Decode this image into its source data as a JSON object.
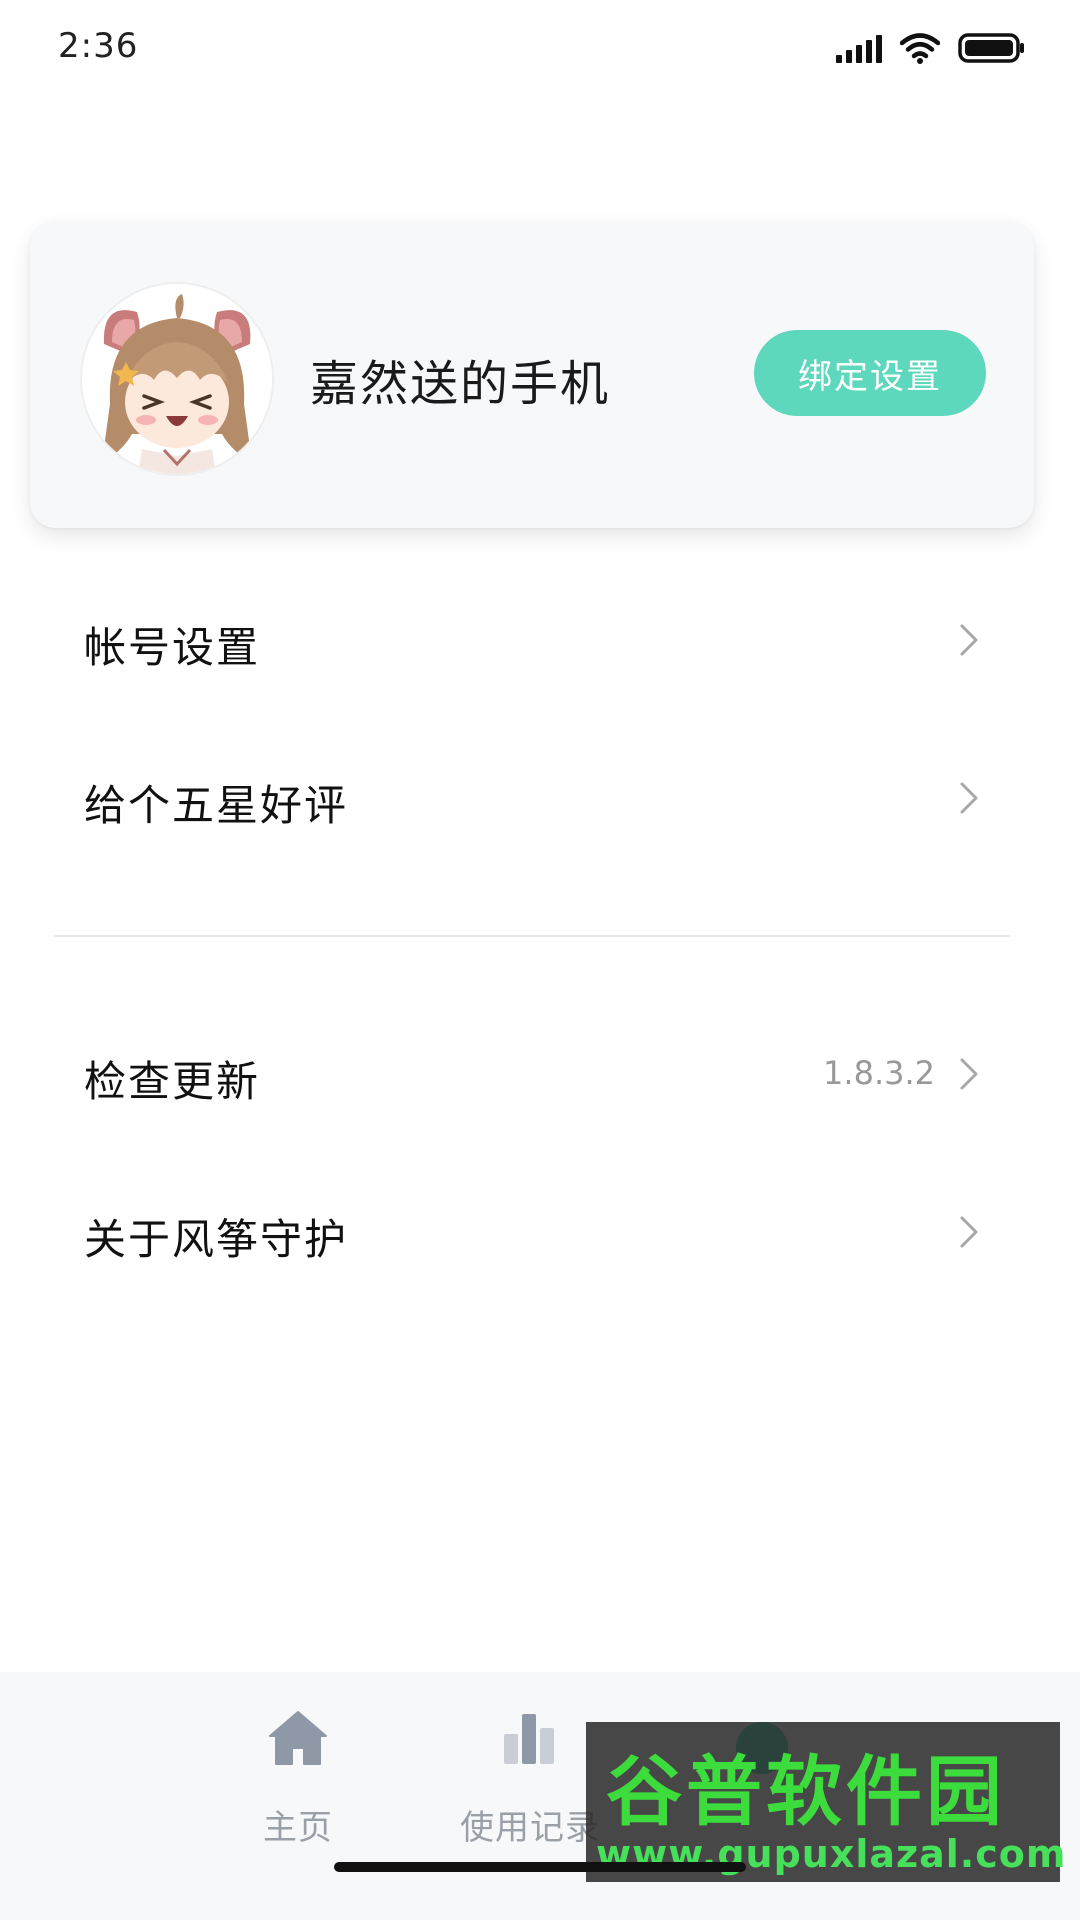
{
  "status_bar": {
    "time": "2:36",
    "icons": [
      "signal-icon",
      "wifi-icon",
      "battery-icon"
    ]
  },
  "profile": {
    "device_name": "嘉然送的手机",
    "bind_button_label": "绑定设置",
    "avatar_icon": "anime-girl-avatar"
  },
  "menu": {
    "items": [
      {
        "label": "帐号设置",
        "value": ""
      },
      {
        "label": "给个五星好评",
        "value": ""
      },
      {
        "label": "检查更新",
        "value": "1.8.3.2"
      },
      {
        "label": "关于风筝守护",
        "value": ""
      }
    ]
  },
  "bottom_nav": {
    "items": [
      {
        "label": "主页",
        "icon": "home-icon"
      },
      {
        "label": "使用记录",
        "icon": "bar-chart-icon"
      },
      {
        "label": "",
        "icon": "mine-icon"
      }
    ]
  },
  "watermark": {
    "brand": "谷普软件园",
    "url": "www.gupuxlazal.com"
  },
  "colors": {
    "accent": "#5ed8bc",
    "nav_inactive": "#9aa0a8",
    "card_bg": "#f7f8fa"
  }
}
